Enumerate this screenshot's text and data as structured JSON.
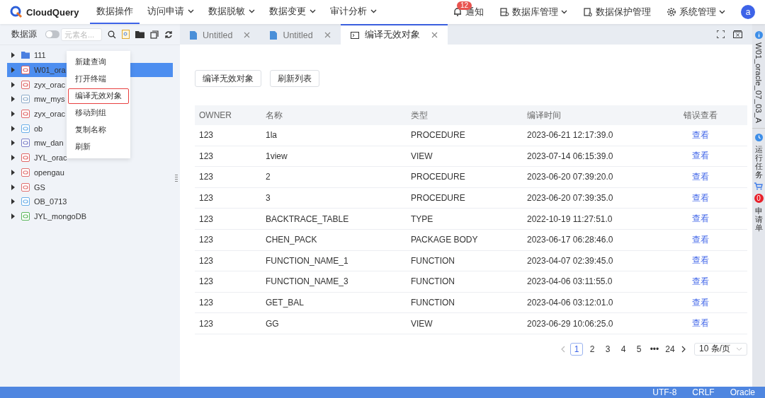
{
  "app": {
    "name": "CloudQuery"
  },
  "nav": [
    {
      "label": "数据操作",
      "selected": true,
      "dropdown": false
    },
    {
      "label": "访问申请",
      "selected": false,
      "dropdown": true
    },
    {
      "label": "数据脱敏",
      "selected": false,
      "dropdown": true
    },
    {
      "label": "数据变更",
      "selected": false,
      "dropdown": true
    },
    {
      "label": "审计分析",
      "selected": false,
      "dropdown": true
    }
  ],
  "header_right": [
    {
      "kind": "bell",
      "label": "通知",
      "badge": "12",
      "dropdown": false
    },
    {
      "kind": "db",
      "label": "数据库管理",
      "dropdown": true
    },
    {
      "kind": "shield",
      "label": "数据保护管理",
      "dropdown": false
    },
    {
      "kind": "gear",
      "label": "系统管理",
      "dropdown": true
    }
  ],
  "avatar": "a",
  "sidebar": {
    "title": "数据源",
    "toggle_on": false,
    "search_placeholder": "元素名...",
    "items": [
      {
        "label": "111",
        "kind": "folder",
        "selected": false
      },
      {
        "label": "W01_ora",
        "kind": "oracle",
        "selected": true
      },
      {
        "label": "zyx_orac",
        "kind": "oracle",
        "selected": false
      },
      {
        "label": "mw_mys",
        "kind": "mysql",
        "selected": false
      },
      {
        "label": "zyx_orac",
        "kind": "oracle",
        "selected": false
      },
      {
        "label": "ob",
        "kind": "ob",
        "selected": false
      },
      {
        "label": "mw_dan",
        "kind": "dameng",
        "selected": false
      },
      {
        "label": "JYL_orac",
        "kind": "oracle",
        "selected": false
      },
      {
        "label": "opengau",
        "kind": "gauss",
        "selected": false
      },
      {
        "label": "GS",
        "kind": "gauss",
        "selected": false
      },
      {
        "label": "OB_0713",
        "kind": "ob",
        "selected": false
      },
      {
        "label": "JYL_mongoDB",
        "kind": "mongo",
        "selected": false
      }
    ]
  },
  "context_menu": [
    {
      "label": "新建查询",
      "selected": false
    },
    {
      "label": "打开终端",
      "selected": false
    },
    {
      "label": "编译无效对象",
      "selected": true
    },
    {
      "label": "移动到组",
      "selected": false
    },
    {
      "label": "复制名称",
      "selected": false
    },
    {
      "label": "刷新",
      "selected": false
    }
  ],
  "tabs": [
    {
      "label": "Untitled",
      "kind": "file",
      "selected": false
    },
    {
      "label": "Untitled",
      "kind": "file",
      "selected": false
    },
    {
      "label": "编译无效对象",
      "kind": "terminal",
      "selected": true
    }
  ],
  "buttons": [
    "编译无效对象",
    "刷新列表"
  ],
  "table": {
    "columns": [
      "OWNER",
      "名称",
      "类型",
      "编译时间",
      "错误查看"
    ],
    "rows": [
      [
        "123",
        "1la",
        "PROCEDURE",
        "2023-06-21 12:17:39.0",
        "查看"
      ],
      [
        "123",
        "1view",
        "VIEW",
        "2023-07-14 06:15:39.0",
        "查看"
      ],
      [
        "123",
        "2",
        "PROCEDURE",
        "2023-06-20 07:39:20.0",
        "查看"
      ],
      [
        "123",
        "3",
        "PROCEDURE",
        "2023-06-20 07:39:35.0",
        "查看"
      ],
      [
        "123",
        "BACKTRACE_TABLE",
        "TYPE",
        "2022-10-19 11:27:51.0",
        "查看"
      ],
      [
        "123",
        "CHEN_PACK",
        "PACKAGE BODY",
        "2023-06-17 06:28:46.0",
        "查看"
      ],
      [
        "123",
        "FUNCTION_NAME_1",
        "FUNCTION",
        "2023-04-07 02:39:45.0",
        "查看"
      ],
      [
        "123",
        "FUNCTION_NAME_3",
        "FUNCTION",
        "2023-04-06 03:11:55.0",
        "查看"
      ],
      [
        "123",
        "GET_BAL",
        "FUNCTION",
        "2023-04-06 03:12:01.0",
        "查看"
      ],
      [
        "123",
        "GG",
        "VIEW",
        "2023-06-29 10:06:25.0",
        "查看"
      ]
    ]
  },
  "pagination": {
    "pages": [
      {
        "label": "1",
        "selected": true
      },
      {
        "label": "2",
        "selected": false
      },
      {
        "label": "3",
        "selected": false
      },
      {
        "label": "4",
        "selected": false
      },
      {
        "label": "5",
        "selected": false
      },
      {
        "label": "•••",
        "selected": false
      },
      {
        "label": "24",
        "selected": false
      }
    ],
    "page_size": "10 条/页"
  },
  "right_panel": {
    "object": "W01_oracle_07_03_A",
    "tasks": "运行任务",
    "cart_count": "0",
    "apply": "申请单"
  },
  "status_bar": [
    "UTF-8",
    "CRLF",
    "Oracle"
  ]
}
